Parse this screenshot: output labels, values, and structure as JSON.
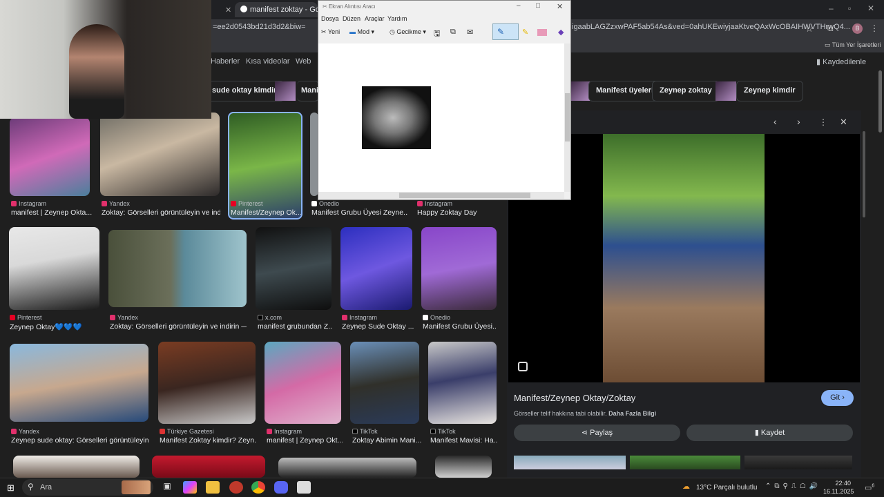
{
  "browser": {
    "tab_active": "manifest zoktay - Google'da",
    "url_left": "=ee2d0543bd21d3d2&biw=",
    "url_right": "igaabLAGZzxwPAF5ab54As&ved=0ahUKEwiyjaaKtveQAxWcOBAIHWVTHrwQ4...",
    "bookmarks_all": "Tüm Yer İşaretleri",
    "profile_initial": "B"
  },
  "search": {
    "nav_tabs": [
      "Haberler",
      "Kısa videolar",
      "Web"
    ],
    "saved_label": "Kaydedilenler",
    "chips": [
      "sude oktay kimdir",
      "Manif",
      "Manifest üyeleri",
      "Zeynep zoktay",
      "Zeynep kimdir"
    ],
    "results_row1": [
      {
        "source": "Instagram",
        "caption": "manifest | Zeynep Okta..."
      },
      {
        "source": "Yandex",
        "caption": "Zoktay: Görselleri görüntüleyin ve ind..."
      },
      {
        "source": "Pinterest",
        "caption": "Manifest/Zeynep Ok..."
      },
      {
        "source": "Onedio",
        "caption": "Manifest Grubu Üyesi Zeyne..."
      },
      {
        "source": "Instagram",
        "caption": "Happy Zoktay Day"
      }
    ],
    "results_row2": [
      {
        "source": "Pinterest",
        "caption": "Zeynep Oktay💙💙💙"
      },
      {
        "source": "Yandex",
        "caption": "Zoktay: Görselleri görüntüleyin ve indirin —..."
      },
      {
        "source": "x.com",
        "caption": "manifest grubundan Z..."
      },
      {
        "source": "Instagram",
        "caption": "Zeynep Sude Oktay ..."
      },
      {
        "source": "Onedio",
        "caption": "Manifest Grubu Üyesi..."
      }
    ],
    "results_row3": [
      {
        "source": "Yandex",
        "caption": "Zeynep sude oktay: Görselleri görüntüleyin ..."
      },
      {
        "source": "Türkiye Gazetesi",
        "caption": "Manifest Zoktay kimdir? Zeyn..."
      },
      {
        "source": "Instagram",
        "caption": "manifest | Zeynep Okt..."
      },
      {
        "source": "TikTok",
        "caption": "Zoktay Abimin Mani..."
      },
      {
        "source": "TikTok",
        "caption": "Manifest Mavisi: Ha..."
      }
    ]
  },
  "panel": {
    "title": "Manifest/Zeynep Oktay/Zoktay",
    "visit": "Git",
    "copyright_note": "Görseller telif hakkına tabi olabilir.",
    "more_info": "Daha Fazla Bilgi",
    "share": "Paylaş",
    "save": "Kaydet"
  },
  "snip": {
    "title": "Ekran Alıntısı Aracı",
    "menu": [
      "Dosya",
      "Düzen",
      "Araçlar",
      "Yardım"
    ],
    "new": "Yeni",
    "mode": "Mod",
    "delay": "Gecikme"
  },
  "taskbar": {
    "search": "Ara",
    "weather": "13°C  Parçalı bulutlu",
    "time": "22:40",
    "date": "16.11.2025",
    "notif": "6"
  },
  "colors": {
    "accent": "#8ab4f8",
    "instagram": "#e1306c",
    "pinterest": "#e60023"
  }
}
